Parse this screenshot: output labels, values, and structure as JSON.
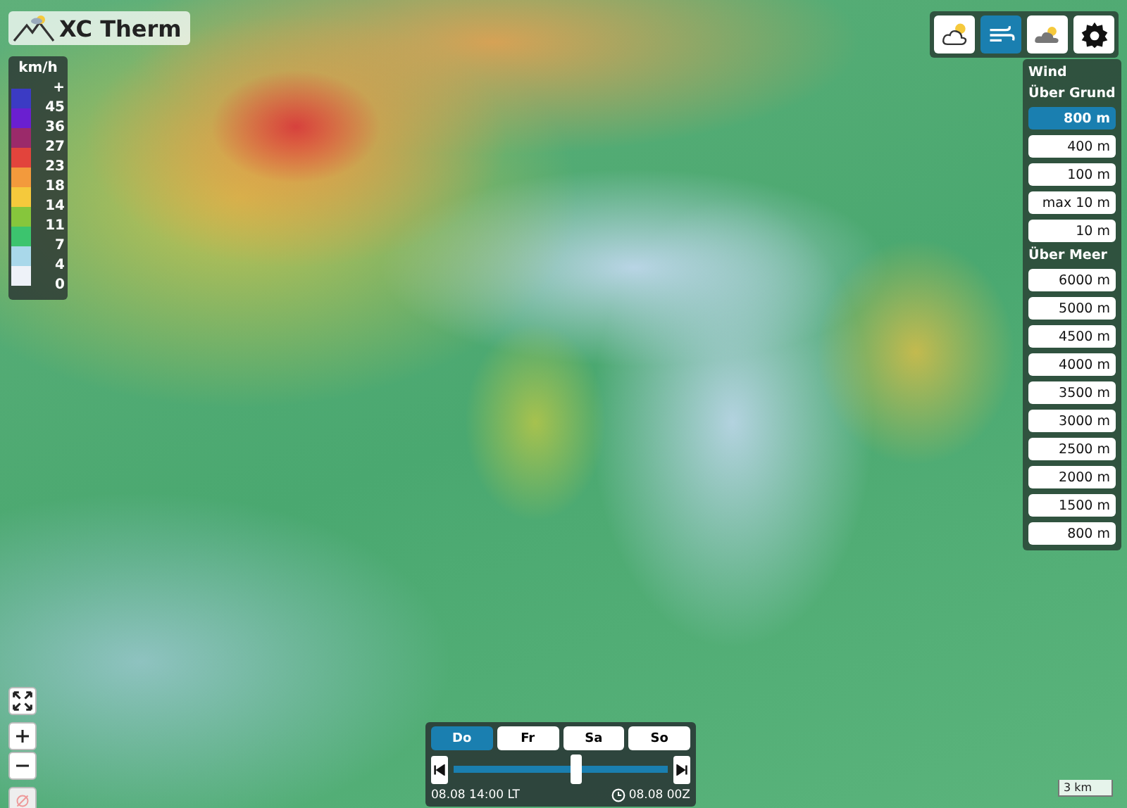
{
  "app": {
    "title": "XC Therm"
  },
  "legend": {
    "unit": "km/h",
    "items": [
      {
        "label": "+",
        "color": "#3b3bc4"
      },
      {
        "label": "45",
        "color": "#6a1fd0"
      },
      {
        "label": "36",
        "color": "#9b2a6a"
      },
      {
        "label": "27",
        "color": "#e2443c"
      },
      {
        "label": "23",
        "color": "#f39a3c"
      },
      {
        "label": "18",
        "color": "#f5c93c"
      },
      {
        "label": "14",
        "color": "#86c63c"
      },
      {
        "label": "11",
        "color": "#3cc46e"
      },
      {
        "label": "7",
        "color": "#a9d8ea"
      },
      {
        "label": "4",
        "color": "#eef2f8"
      }
    ],
    "bottom_label": "0"
  },
  "toolbar": [
    {
      "kind": "weather",
      "selected": false
    },
    {
      "kind": "wind",
      "selected": true
    },
    {
      "kind": "clouds",
      "selected": false
    },
    {
      "kind": "settings",
      "selected": false
    }
  ],
  "wind_panel": {
    "title": "Wind",
    "sections": [
      {
        "heading": "Über Grund",
        "options": [
          {
            "label": "800 m",
            "selected": true
          },
          {
            "label": "400 m",
            "selected": false
          },
          {
            "label": "100 m",
            "selected": false
          },
          {
            "label": "max 10 m",
            "selected": false
          },
          {
            "label": "10 m",
            "selected": false
          }
        ]
      },
      {
        "heading": "Über Meer",
        "options": [
          {
            "label": "6000 m",
            "selected": false
          },
          {
            "label": "5000 m",
            "selected": false
          },
          {
            "label": "4500 m",
            "selected": false
          },
          {
            "label": "4000 m",
            "selected": false
          },
          {
            "label": "3500 m",
            "selected": false
          },
          {
            "label": "3000 m",
            "selected": false
          },
          {
            "label": "2500 m",
            "selected": false
          },
          {
            "label": "2000 m",
            "selected": false
          },
          {
            "label": "1500 m",
            "selected": false
          },
          {
            "label": "800 m",
            "selected": false
          }
        ]
      }
    ]
  },
  "time_control": {
    "days": [
      {
        "label": "Do",
        "selected": true
      },
      {
        "label": "Fr",
        "selected": false
      },
      {
        "label": "Sa",
        "selected": false
      },
      {
        "label": "So",
        "selected": false
      }
    ],
    "level": 0.57,
    "local_time": "08.08 14:00 LT",
    "model_run": "08.08 00Z"
  },
  "scale": {
    "label": "3 km"
  }
}
